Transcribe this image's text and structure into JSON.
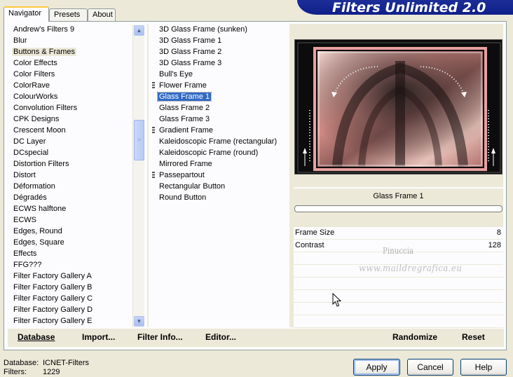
{
  "tabs": [
    {
      "label": "Navigator",
      "active": true
    },
    {
      "label": "Presets",
      "active": false
    },
    {
      "label": "About",
      "active": false
    }
  ],
  "app_title": "Filters Unlimited 2.0",
  "categories": [
    {
      "label": "Andrew's Filters 9"
    },
    {
      "label": "Blur"
    },
    {
      "label": "Buttons & Frames",
      "selected": true
    },
    {
      "label": "Color Effects"
    },
    {
      "label": "Color Filters"
    },
    {
      "label": "ColorRave"
    },
    {
      "label": "ColourWorks"
    },
    {
      "label": "Convolution Filters"
    },
    {
      "label": "CPK Designs"
    },
    {
      "label": "Crescent Moon"
    },
    {
      "label": "DC Layer"
    },
    {
      "label": "DCspecial"
    },
    {
      "label": "Distortion Filters"
    },
    {
      "label": "Distort"
    },
    {
      "label": "Déformation"
    },
    {
      "label": "Dégradés"
    },
    {
      "label": "ECWS halftone"
    },
    {
      "label": "ECWS"
    },
    {
      "label": "Edges, Round"
    },
    {
      "label": "Edges, Square"
    },
    {
      "label": "Effects"
    },
    {
      "label": "FFG???"
    },
    {
      "label": "Filter Factory Gallery A"
    },
    {
      "label": "Filter Factory Gallery B"
    },
    {
      "label": "Filter Factory Gallery C"
    },
    {
      "label": "Filter Factory Gallery D"
    },
    {
      "label": "Filter Factory Gallery E"
    }
  ],
  "filters": [
    {
      "label": "3D Glass Frame (sunken)"
    },
    {
      "label": "3D Glass Frame 1"
    },
    {
      "label": "3D Glass Frame 2"
    },
    {
      "label": "3D Glass Frame 3"
    },
    {
      "label": "Bull's Eye"
    },
    {
      "label": "Flower Frame",
      "group": true
    },
    {
      "label": "Glass Frame 1",
      "selected": true
    },
    {
      "label": "Glass Frame 2"
    },
    {
      "label": "Glass Frame 3"
    },
    {
      "label": "Gradient Frame",
      "group": true
    },
    {
      "label": "Kaleidoscopic Frame (rectangular)"
    },
    {
      "label": "Kaleidoscopic Frame (round)"
    },
    {
      "label": "Mirrored Frame"
    },
    {
      "label": "Passepartout",
      "group": true
    },
    {
      "label": "Rectangular Button"
    },
    {
      "label": "Round Button"
    }
  ],
  "scroll_position": 0.35,
  "selected_filter_label": "Glass Frame 1",
  "progress": 0,
  "params": [
    {
      "name": "Frame Size",
      "value": "8"
    },
    {
      "name": "Contrast",
      "value": "128"
    }
  ],
  "watermark": {
    "line1": "Pinuccia",
    "line2": "www.maildregrafica.eu"
  },
  "bottom_buttons": {
    "database": "Database",
    "import": "Import...",
    "filter_info": "Filter Info...",
    "editor": "Editor...",
    "randomize": "Randomize",
    "reset": "Reset"
  },
  "status": {
    "database_key": "Database:",
    "database_value": "ICNET-Filters",
    "filters_key": "Filters:",
    "filters_value": "1229"
  },
  "dialog_buttons": {
    "apply": "Apply",
    "cancel": "Cancel",
    "help": "Help"
  },
  "colors": {
    "accent_blue": "#316ac5",
    "title_bar": "#1c2d97",
    "frame_pink": "#d88080"
  },
  "icons": {
    "scroll_up": "scroll-up-arrow-icon",
    "scroll_down": "scroll-down-arrow-icon",
    "group": "group-marker-icon",
    "cursor": "mouse-pointer-icon"
  }
}
